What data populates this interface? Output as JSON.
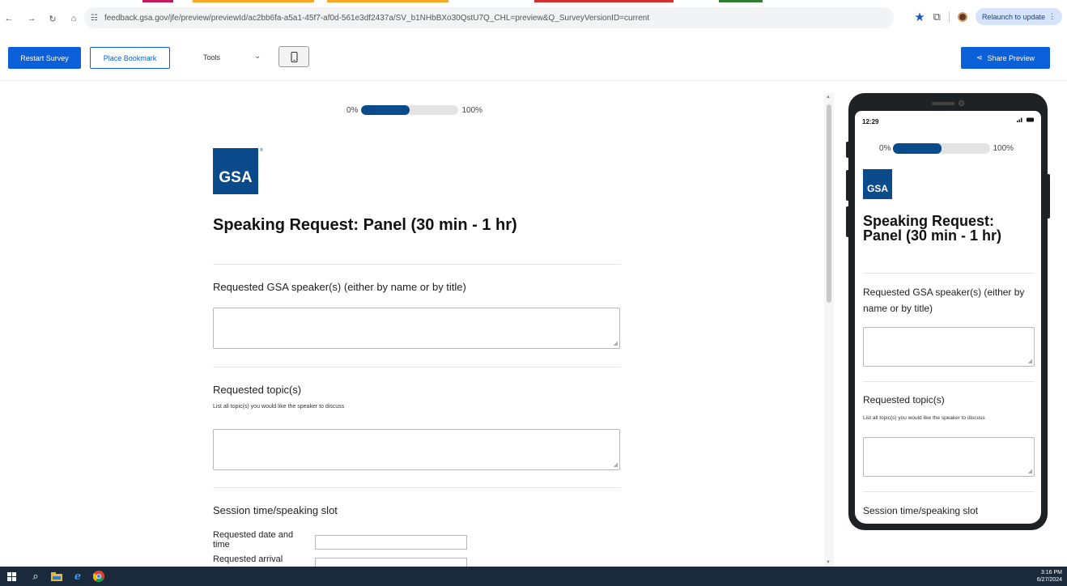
{
  "browser": {
    "url": "feedback.gsa.gov/jfe/preview/previewId/ac2bb6fa-a5a1-45f7-af0d-561e3df2437a/SV_b1NHbBXo30QstU7Q_CHL=preview&Q_SurveyVersionID=current",
    "relaunch_label": "Relaunch to update",
    "tab_accent_colors": [
      "#c2185b",
      "#f9a825",
      "#f9a825",
      "#d32f2f",
      "#2e7d32"
    ]
  },
  "toolbar": {
    "restart_label": "Restart Survey",
    "bookmark_label": "Place Bookmark",
    "tools_label": "Tools",
    "share_label": "Share Preview"
  },
  "survey": {
    "progress_start": "0%",
    "progress_end": "100%",
    "progress_fraction": 0.5,
    "logo_text": "GSA",
    "logo_reg": "®",
    "title": "Speaking Request: Panel (30 min - 1 hr)",
    "q1_label": "Requested GSA speaker(s) (either by name or by title)",
    "q2_label": "Requested topic(s)",
    "q2_sub": "List all topic(s) you would like the speaker to discuss",
    "q3_label": "Session time/speaking slot",
    "q3_row1": "Requested date and time",
    "q3_row2": "Requested arrival"
  },
  "phone": {
    "time": "12:29",
    "q1_label": "Requested GSA speaker(s) (either by name or by title)"
  },
  "taskbar": {
    "time": "3:16 PM",
    "date": "6/27/2024"
  },
  "colors": {
    "primary": "#0b5fd8",
    "gsa_blue": "#0b4a8b",
    "taskbar": "#1b2a3a"
  }
}
